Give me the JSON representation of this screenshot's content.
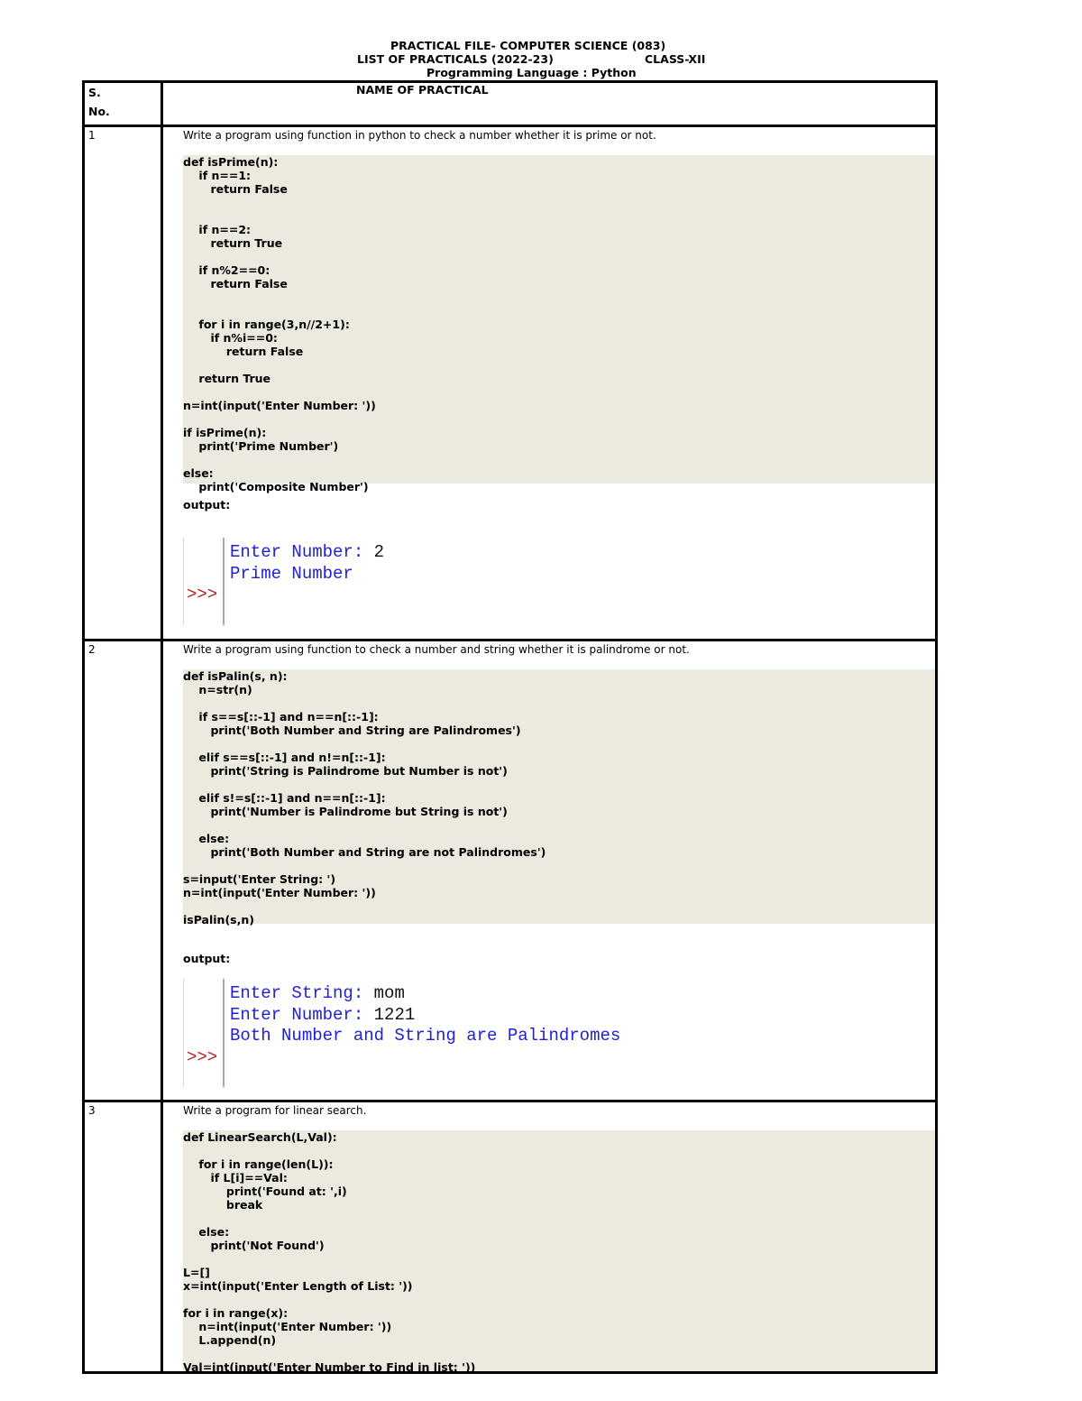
{
  "header": {
    "title": "PRACTICAL FILE- COMPUTER SCIENCE (083)",
    "subtitle": "LIST OF PRACTICALS (2022-23)",
    "class": "CLASS-XII",
    "language": "Programming Language : Python"
  },
  "table": {
    "col_sno": [
      "S.",
      "No."
    ],
    "col_name": "NAME OF PRACTICAL",
    "rows": [
      {
        "sno": "1",
        "task": "Write a program using function in python to check a number whether it is prime or not.",
        "code": [
          "def isPrime(n):",
          "    if n==1:",
          "        return False",
          "",
          "",
          "    if n==2:",
          "        return True",
          "",
          "    if n%2==0:",
          "        return False",
          "",
          "",
          "    for i in range(3,n//2+1):",
          "        if n%i==0:",
          "            return False",
          "",
          "    return True",
          "",
          "n=int(input('Enter Number: '))",
          "",
          "if isPrime(n):",
          "    print('Prime Number')",
          "",
          "else:",
          "    print('Composite Number')"
        ],
        "output_label": "output:",
        "shell": [
          {
            "prompt": "Enter Number: ",
            "value": "2"
          },
          {
            "prompt": "Prime Number",
            "value": ""
          }
        ],
        "shell_prompt": ">>>"
      },
      {
        "sno": "2",
        "task": "Write a program using function to check a number and string whether it is palindrome or not.",
        "code": [
          "def isPalin(s, n):",
          "    n=str(n)",
          "",
          "    if s==s[::-1] and n==n[::-1]:",
          "        print('Both Number and String are Palindromes')",
          "",
          "    elif s==s[::-1] and n!=n[::-1]:",
          "        print('String is Palindrome but Number is not')",
          "",
          "    elif s!=s[::-1] and n==n[::-1]:",
          "        print('Number is Palindrome but String is not')",
          "",
          "    else:",
          "        print('Both Number and String are not Palindromes')",
          "",
          "s=input('Enter String: ')",
          "n=int(input('Enter Number: '))",
          "",
          "isPalin(s,n)"
        ],
        "output_label": "output:",
        "shell": [
          {
            "prompt": "Enter String: ",
            "value": "mom"
          },
          {
            "prompt": "Enter Number: ",
            "value": "1221"
          },
          {
            "prompt": "Both Number and String are Palindromes",
            "value": ""
          }
        ],
        "shell_prompt": ">>>"
      },
      {
        "sno": "3",
        "task": "Write a program for linear search.",
        "code": [
          "def LinearSearch(L,Val):",
          "",
          "    for i in range(len(L)):",
          "        if L[i]==Val:",
          "            print('Found at: ',i)",
          "            break",
          "",
          "    else:",
          "        print('Not Found')",
          "",
          "L=[]",
          "x=int(input('Enter Length of List: '))",
          "",
          "for i in range(x):",
          "    n=int(input('Enter Number: '))",
          "    L.append(n)",
          "",
          "Val=int(input('Enter Number to Find in list: '))"
        ]
      }
    ]
  },
  "colors": {
    "code_background": "#ece9df",
    "shell_text": "#2020d8",
    "shell_prompt": "#b22222"
  }
}
